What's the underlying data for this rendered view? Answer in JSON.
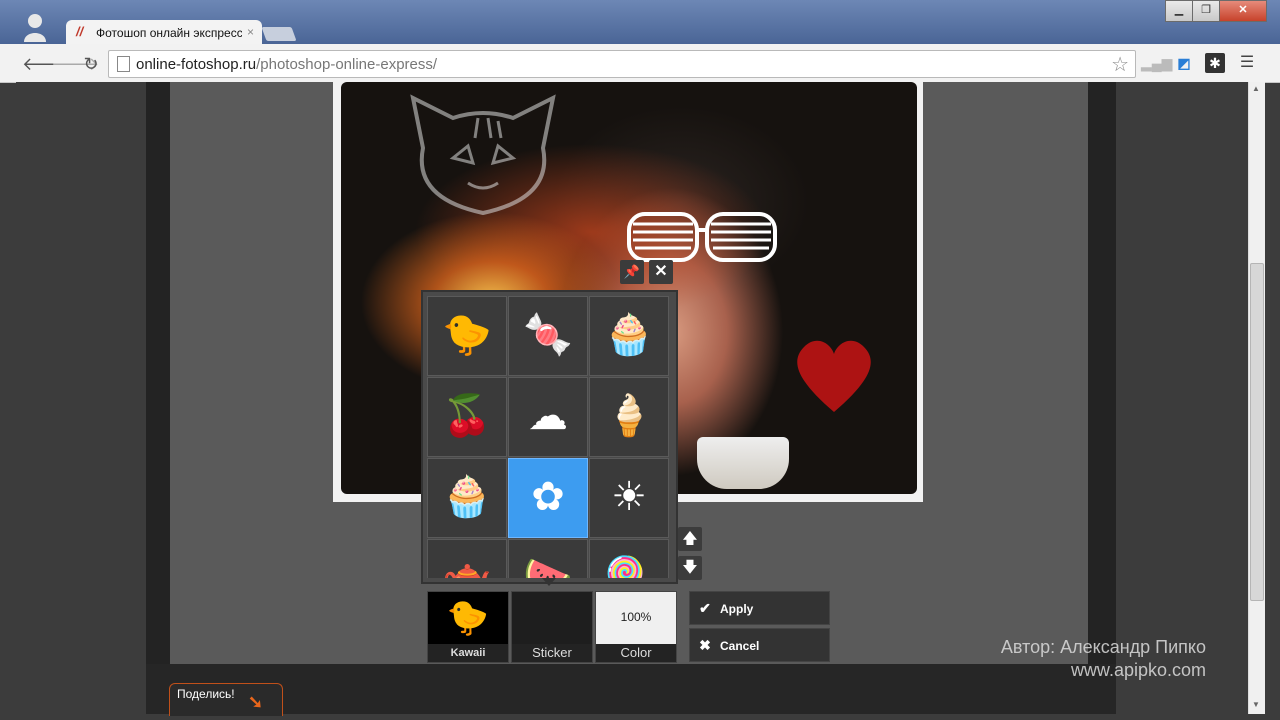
{
  "browser": {
    "tab_title": "Фотошоп онлайн экспресс",
    "tab_close": "×",
    "url_host": "online-fotoshop.ru",
    "url_path": "/photoshop-online-express/",
    "window_buttons": {
      "minimize": "▁",
      "maximize": "❐",
      "close": "✕"
    }
  },
  "editor": {
    "sticker_controls": {
      "pin": "📌",
      "close": "✕"
    },
    "stickers": [
      {
        "icon": "chick",
        "glyph": "🐤"
      },
      {
        "icon": "candy",
        "glyph": "🍬"
      },
      {
        "icon": "cupcake",
        "glyph": "🧁"
      },
      {
        "icon": "cherries",
        "glyph": "🍒"
      },
      {
        "icon": "cloud",
        "glyph": "☁"
      },
      {
        "icon": "ice-cream",
        "glyph": "🍦"
      },
      {
        "icon": "cupcake-bow",
        "glyph": "🧁"
      },
      {
        "icon": "flower",
        "glyph": "✿"
      },
      {
        "icon": "sun",
        "glyph": "☀"
      },
      {
        "icon": "teapot",
        "glyph": "🫖"
      },
      {
        "icon": "watermelon",
        "glyph": "🍉"
      },
      {
        "icon": "lollipop",
        "glyph": "🍭"
      }
    ],
    "selected_sticker_index": 7,
    "scroll_up": "🡅",
    "scroll_down": "🡇",
    "tools": {
      "category_label": "Kawaii",
      "sticker_label": "Sticker",
      "color_label": "Color",
      "opacity": "100%"
    },
    "apply_label": "Apply",
    "cancel_label": "Cancel"
  },
  "share_label": "Поделись!",
  "watermark": {
    "author": "Автор: Александр Пипко",
    "site": "www.apipko.com"
  },
  "colors": {
    "selected_cell": "#3d9cf0",
    "share_accent": "#e8661c"
  }
}
